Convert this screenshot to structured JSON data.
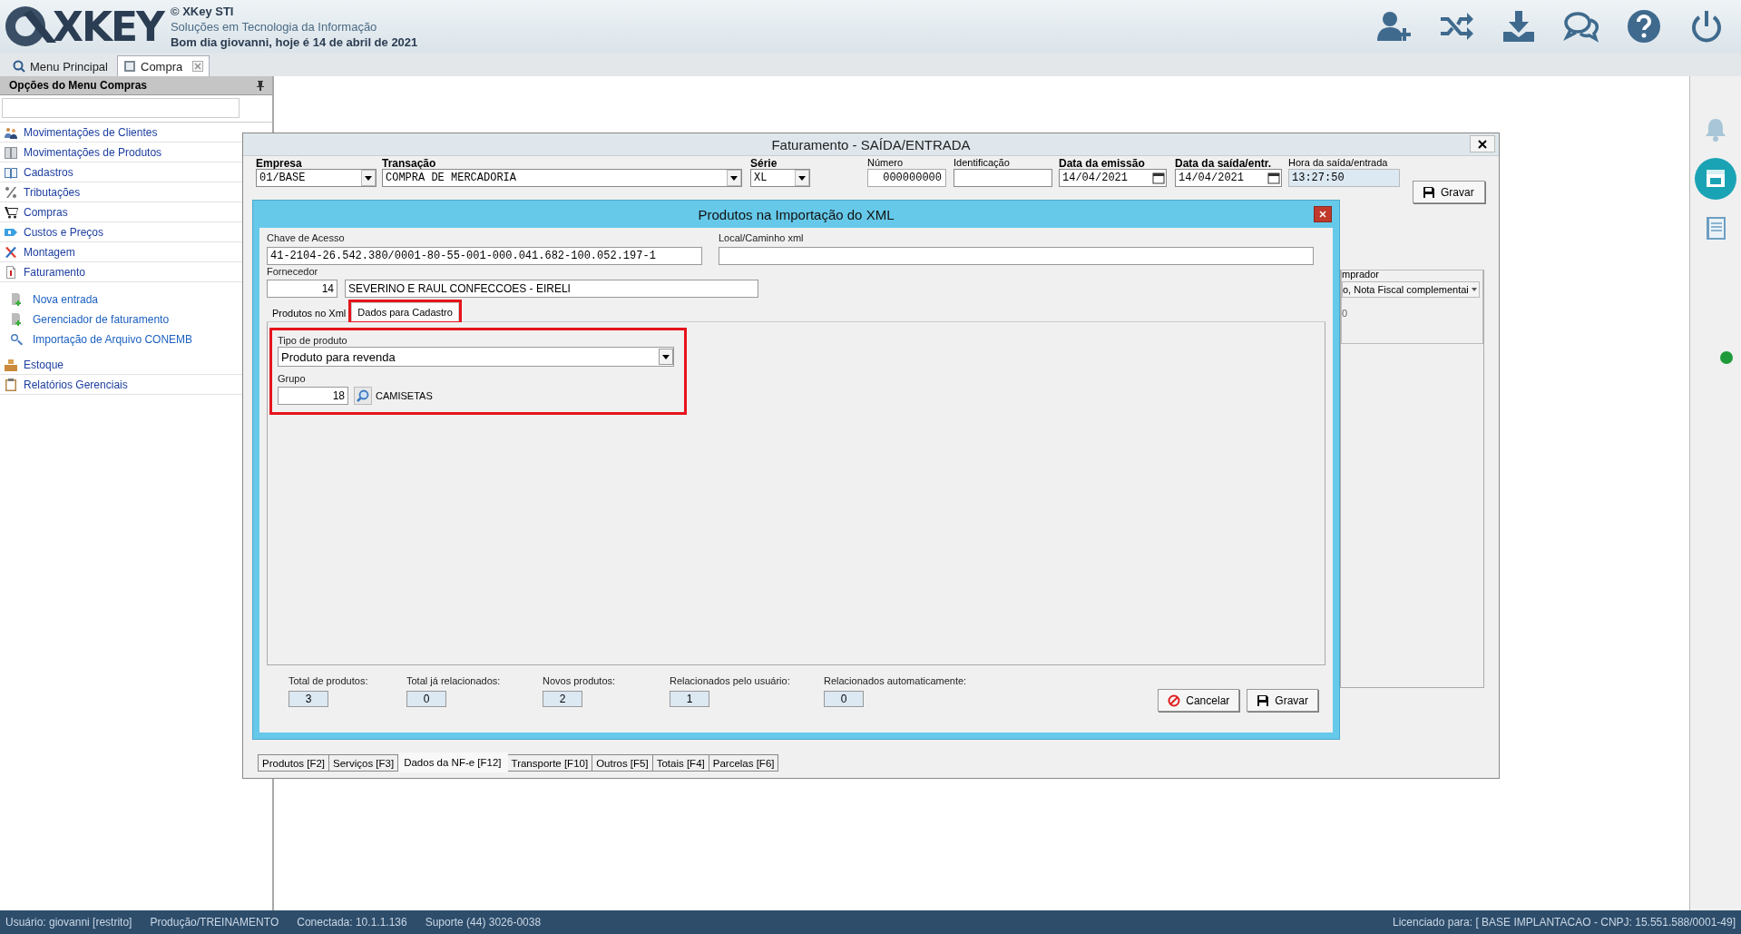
{
  "logo": "XKEY",
  "header": {
    "copyright": "© XKey STI",
    "tagline": "Soluções em Tecnologia da Informação",
    "greeting": "Bom dia giovanni, hoje é 14 de abril de 2021"
  },
  "tabs": [
    {
      "label": "Menu Principal",
      "selected": false,
      "closable": false
    },
    {
      "label": "Compra",
      "selected": true,
      "closable": true
    }
  ],
  "sidebar": {
    "title": "Opções do Menu Compras",
    "items": [
      {
        "label": "Movimentações de Clientes"
      },
      {
        "label": "Movimentações de Produtos"
      },
      {
        "label": "Cadastros"
      },
      {
        "label": "Tributações"
      },
      {
        "label": "Compras"
      },
      {
        "label": "Custos e Preços"
      },
      {
        "label": "Montagem"
      },
      {
        "label": "Faturamento",
        "children": [
          {
            "label": "Nova entrada"
          },
          {
            "label": "Gerenciador de faturamento"
          },
          {
            "label": "Importação de Arquivo CONEMB"
          }
        ]
      },
      {
        "label": "Estoque"
      },
      {
        "label": "Relatórios Gerenciais"
      }
    ]
  },
  "window": {
    "title": "Faturamento - SAÍDA/ENTRADA",
    "fields": [
      {
        "label": "Empresa",
        "bold": true,
        "kind": "select",
        "value": "01/BASE"
      },
      {
        "label": "Transação",
        "bold": true,
        "kind": "select",
        "value": "COMPRA DE MERCADORIA"
      },
      {
        "label": "Série",
        "bold": true,
        "kind": "select",
        "value": "XL"
      },
      {
        "label": "Número",
        "bold": false,
        "kind": "number",
        "value": "000000000"
      },
      {
        "label": "Identificação",
        "bold": false,
        "kind": "text"
      },
      {
        "label": "Data da emissão",
        "bold": true,
        "kind": "date",
        "value": "14/04/2021"
      },
      {
        "label": "Data da saída/entr.",
        "bold": true,
        "kind": "date",
        "value": "14/04/2021"
      },
      {
        "label": "Hora da saída/entrada",
        "bold": false,
        "kind": "readonly",
        "value": "13:27:50"
      }
    ],
    "save_button": "Gravar",
    "side_group": {
      "label": "mprador",
      "select_value": "o, Nota Fiscal complementai",
      "text": "0"
    },
    "bottom_tabs": [
      {
        "label": "Produtos [F2]",
        "selected": false
      },
      {
        "label": "Serviços [F3]",
        "selected": false
      },
      {
        "label": "Dados da NF-e [F12]",
        "selected": true
      },
      {
        "label": "Transporte [F10]",
        "selected": false
      },
      {
        "label": "Outros [F5]",
        "selected": false
      },
      {
        "label": "Totais [F4]",
        "selected": false
      },
      {
        "label": "Parcelas [F6]",
        "selected": false
      }
    ]
  },
  "dialog": {
    "title": "Produtos na Importação do XML",
    "access_key": {
      "label": "Chave de Acesso",
      "value": "41-2104-26.542.380/0001-80-55-001-000.041.682-100.052.197-1"
    },
    "xml_path": {
      "label": "Local/Caminho xml"
    },
    "supplier": {
      "label": "Fornecedor",
      "code": "14",
      "name": "SEVERINO E RAUL CONFECCOES - EIRELI"
    },
    "tabs": [
      {
        "label": "Produtos no Xml",
        "selected": false,
        "highlighted": false
      },
      {
        "label": "Dados para Cadastro",
        "selected": true,
        "highlighted": true
      }
    ],
    "section_highlighted": true,
    "product_type": {
      "label": "Tipo de produto",
      "value": "Produto para revenda"
    },
    "group": {
      "label": "Grupo",
      "code": "18",
      "name": "CAMISETAS"
    },
    "totals": [
      {
        "label": "Total de produtos:",
        "value": "3"
      },
      {
        "label": "Total já relacionados:",
        "value": "0"
      },
      {
        "label": "Novos produtos:",
        "value": "2"
      },
      {
        "label": "Relacionados pelo usuário:",
        "value": "1"
      },
      {
        "label": "Relacionados automaticamente:",
        "value": "0"
      }
    ],
    "buttons": [
      {
        "label": "Cancelar",
        "kind": "cancel"
      },
      {
        "label": "Gravar",
        "kind": "save"
      }
    ]
  },
  "status_bar": {
    "items": [
      "Usuário: giovanni [restrito]",
      "Produção/TREINAMENTO",
      "Conectada: 10.1.1.136",
      "Suporte (44) 3026-0038"
    ],
    "license": "Licenciado para: [ BASE IMPLANTACAO - CNPJ: 15.551.588/0001-49]"
  }
}
